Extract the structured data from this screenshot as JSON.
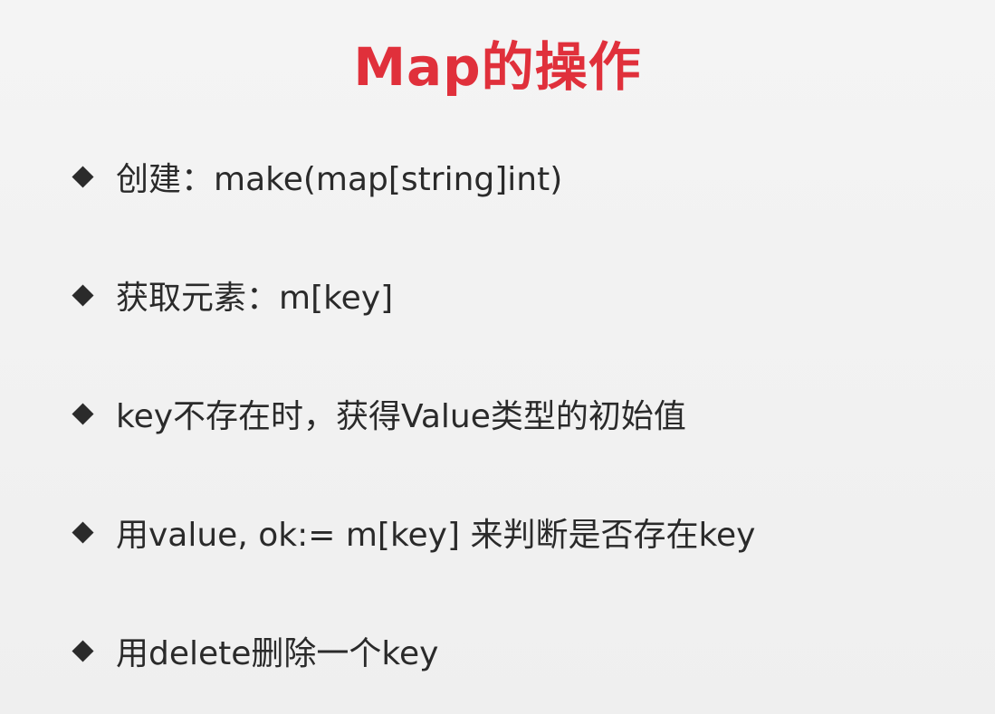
{
  "slide": {
    "title": "Map的操作",
    "bullets": [
      "创建：make(map[string]int)",
      "获取元素：m[key]",
      "key不存在时，获得Value类型的初始值",
      "用value, ok:= m[key] 来判断是否存在key",
      "用delete删除一个key"
    ]
  },
  "colors": {
    "title": "#e0303b",
    "text": "#2a2a2a",
    "background": "#f2f2f2"
  },
  "icons": {
    "bullet_marker": "diamond-bullet-icon"
  }
}
